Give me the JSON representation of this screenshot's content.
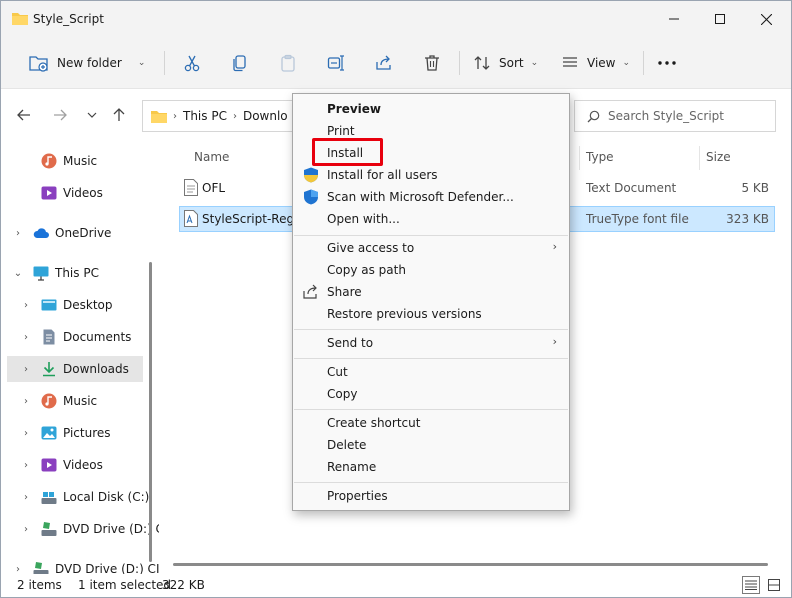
{
  "window": {
    "title": "Style_Script"
  },
  "toolbar": {
    "new_folder": "New folder",
    "sort": "Sort",
    "view": "View"
  },
  "address": {
    "crumbs": [
      "This PC",
      "Downlo"
    ]
  },
  "search": {
    "placeholder": "Search Style_Script"
  },
  "nav": {
    "items": [
      {
        "label": "Music"
      },
      {
        "label": "Videos"
      },
      {
        "label": "OneDrive"
      },
      {
        "label": "This PC"
      },
      {
        "label": "Desktop"
      },
      {
        "label": "Documents"
      },
      {
        "label": "Downloads"
      },
      {
        "label": "Music"
      },
      {
        "label": "Pictures"
      },
      {
        "label": "Videos"
      },
      {
        "label": "Local Disk (C:)"
      },
      {
        "label": "DVD Drive (D:) C"
      },
      {
        "label": "DVD Drive (D:) CI"
      }
    ]
  },
  "columns": {
    "name": "Name",
    "type": "Type",
    "size": "Size"
  },
  "files": [
    {
      "name": "OFL",
      "type": "Text Document",
      "size": "5 KB"
    },
    {
      "name": "StyleScript-Regul",
      "type": "TrueType font file",
      "size": "323 KB"
    }
  ],
  "status": {
    "items": "2 items",
    "selected": "1 item selected",
    "size": "322 KB"
  },
  "context_menu": {
    "preview": "Preview",
    "print": "Print",
    "install": "Install",
    "install_all": "Install for all users",
    "scan": "Scan with Microsoft Defender...",
    "open_with": "Open with...",
    "give_access": "Give access to",
    "copy_path": "Copy as path",
    "share": "Share",
    "restore": "Restore previous versions",
    "send_to": "Send to",
    "cut": "Cut",
    "copy": "Copy",
    "create_shortcut": "Create shortcut",
    "delete": "Delete",
    "rename": "Rename",
    "properties": "Properties"
  },
  "colors": {
    "selection": "#cce8ff",
    "highlight_box": "#e8000d",
    "accent": "#0067c0"
  }
}
